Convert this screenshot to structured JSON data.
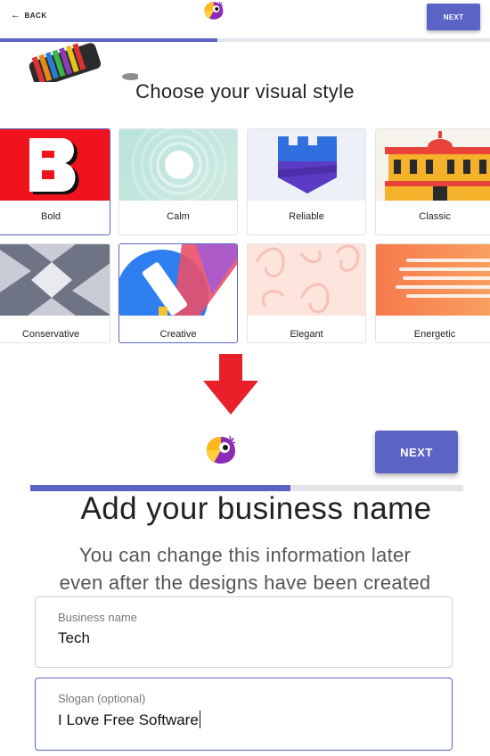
{
  "top": {
    "back_label": "BACK",
    "next_label": "NEXT",
    "progress_fraction": 0.44,
    "title": "Choose your visual style",
    "styles": [
      {
        "label": "Bold",
        "selected": true
      },
      {
        "label": "Calm",
        "selected": false
      },
      {
        "label": "Reliable",
        "selected": false
      },
      {
        "label": "Classic",
        "selected": false
      },
      {
        "label": "Conservative",
        "selected": false
      },
      {
        "label": "Creative",
        "selected": true
      },
      {
        "label": "Elegant",
        "selected": false
      },
      {
        "label": "Energetic",
        "selected": false
      }
    ]
  },
  "bottom": {
    "next_label": "NEXT",
    "progress_fraction": 0.6,
    "title": "Add your business name",
    "subtitle_line1": "You can change this information later",
    "subtitle_line2": "even after the designs have been created",
    "business_name": {
      "label": "Business name",
      "value": "Tech"
    },
    "slogan": {
      "label": "Slogan (optional)",
      "value": "I Love Free Software"
    }
  },
  "colors": {
    "accent": "#5b64c4",
    "arrow_red": "#e8202a"
  }
}
